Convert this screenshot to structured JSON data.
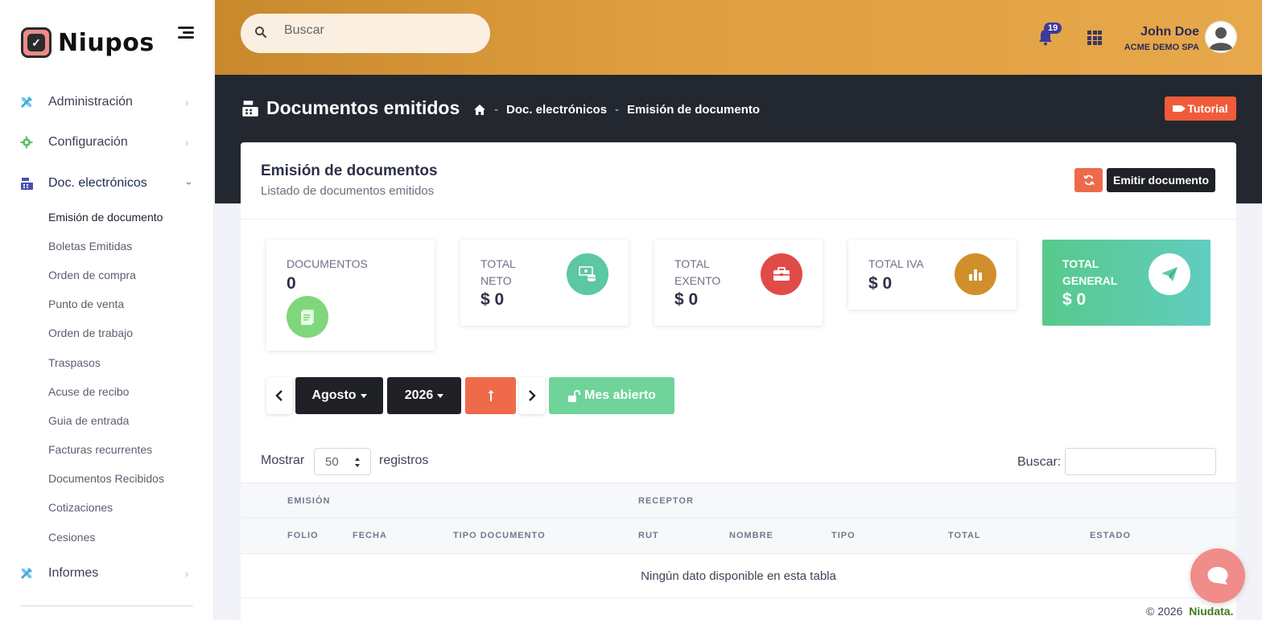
{
  "brand": {
    "name": "Niupos"
  },
  "sidebar": {
    "items": [
      {
        "label": "Administración",
        "icon": "tools-icon",
        "color": "#3fa9e0"
      },
      {
        "label": "Configuración",
        "icon": "gear-icon",
        "color": "#5fbf6a"
      },
      {
        "label": "Doc. electrónicos",
        "icon": "cash-register-icon",
        "color": "#4a4fb0"
      },
      {
        "label": "Informes",
        "icon": "tools-icon",
        "color": "#3fa9e0"
      }
    ],
    "sub_items": [
      "Emisión de documento",
      "Boletas Emitidas",
      "Orden de compra",
      "Punto de venta",
      "Orden de trabajo",
      "Traspasos",
      "Acuse de recibo",
      "Guia de entrada",
      "Facturas recurrentes",
      "Documentos Recibidos",
      "Cotizaciones",
      "Cesiones"
    ]
  },
  "header": {
    "search_placeholder": "Buscar",
    "notification_count": "19",
    "user_name": "John Doe",
    "user_company": "ACME DEMO SPA"
  },
  "subheader": {
    "title": "Documentos emitidos",
    "breadcrumb": [
      "Doc. electrónicos",
      "Emisión de documento"
    ],
    "tutorial_label": "Tutorial"
  },
  "card": {
    "title": "Emisión de documentos",
    "subtitle": "Listado de documentos emitidos",
    "emit_label": "Emitir documento"
  },
  "stats": [
    {
      "label": "DOCUMENTOS",
      "value": "0",
      "color": "#7ed77a"
    },
    {
      "label": "TOTAL NETO",
      "value": "$ 0",
      "color": "#5cc7a4"
    },
    {
      "label": "TOTAL EXENTO",
      "value": "$ 0",
      "color": "#e04b48"
    },
    {
      "label": "TOTAL IVA",
      "value": "$ 0",
      "color": "#d08f2a"
    },
    {
      "label": "TOTAL GENERAL",
      "value": "$ 0",
      "color": "#ffffff"
    }
  ],
  "period": {
    "month": "Agosto",
    "year": "2026",
    "status_label": "Mes abierto"
  },
  "table": {
    "show_label": "Mostrar",
    "page_size": "50",
    "records_label": "registros",
    "search_label": "Buscar:",
    "group_headers": [
      "EMISIÓN",
      "RECEPTOR"
    ],
    "columns": [
      "FOLIO",
      "FECHA",
      "TIPO DOCUMENTO",
      "RUT",
      "NOMBRE",
      "TIPO",
      "TOTAL",
      "ESTADO"
    ],
    "empty_message": "Ningún dato disponible en esta tabla"
  },
  "footer": {
    "copyright": "© 2026",
    "company": "Niudata."
  }
}
